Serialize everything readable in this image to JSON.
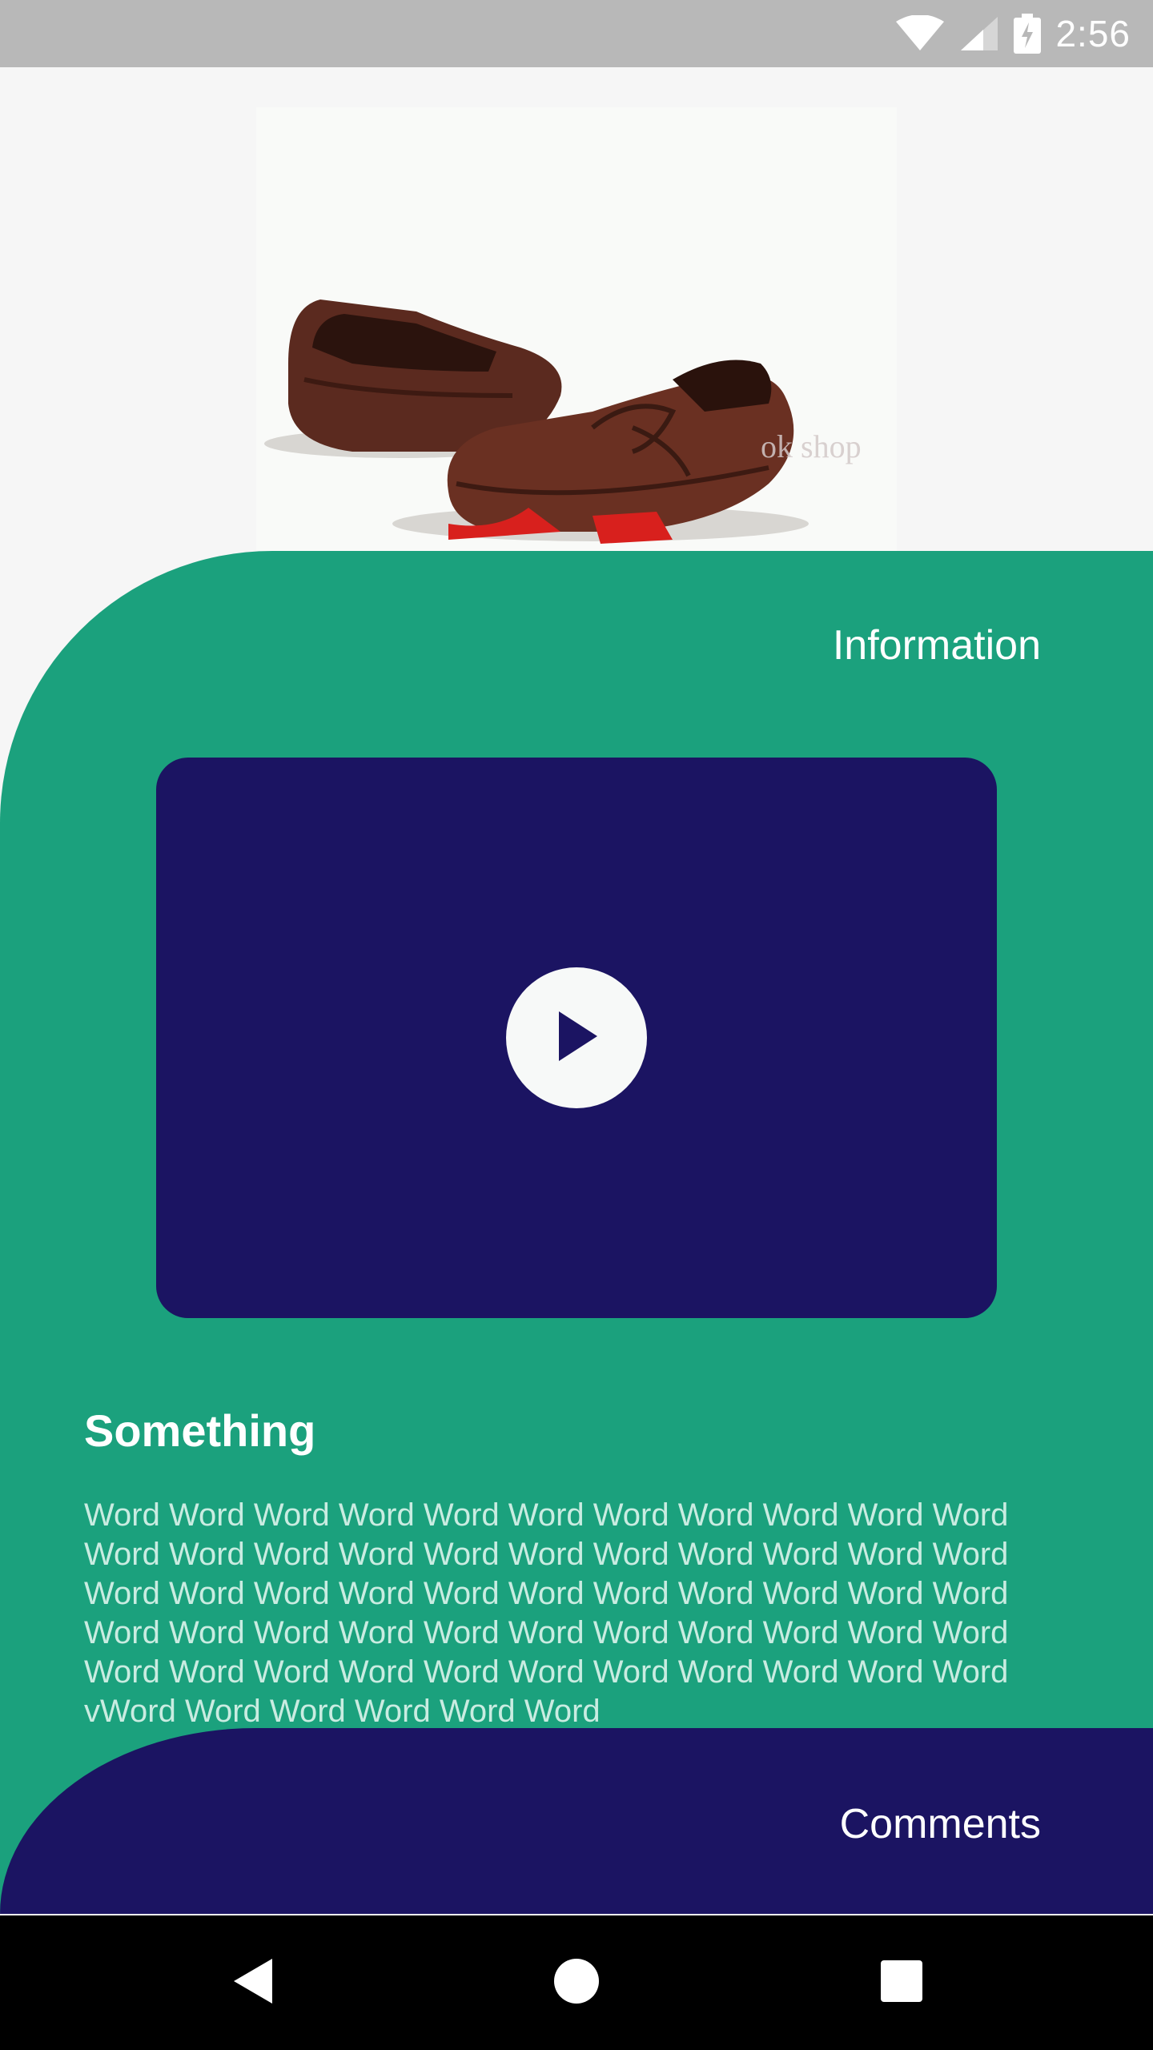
{
  "status_bar": {
    "time": "2:56",
    "icons": [
      "wifi-icon",
      "signal-icon",
      "battery-charging-icon"
    ]
  },
  "hero": {
    "image_alt": "brown leather loafers",
    "watermark": "ok shop"
  },
  "information": {
    "title": "Information",
    "video": {
      "play_icon": "play-icon"
    },
    "section_title": "Something",
    "body": "Word Word Word Word Word Word Word Word Word Word Word Word Word Word Word Word Word Word Word Word Word Word Word Word Word Word Word Word Word Word Word Word Word Word Word Word Word Word Word Word Word Word Word Word Word Word Word Word Word Word Word Word Word Word Word vWord Word Word Word Word Word"
  },
  "comments": {
    "title": "Comments"
  },
  "nav_bar": {
    "icons": [
      "back-icon",
      "home-icon",
      "recents-icon"
    ]
  },
  "colors": {
    "accent_green": "#1ba17d",
    "navy": "#1b1462",
    "status_bar": "#b8b8b8"
  }
}
